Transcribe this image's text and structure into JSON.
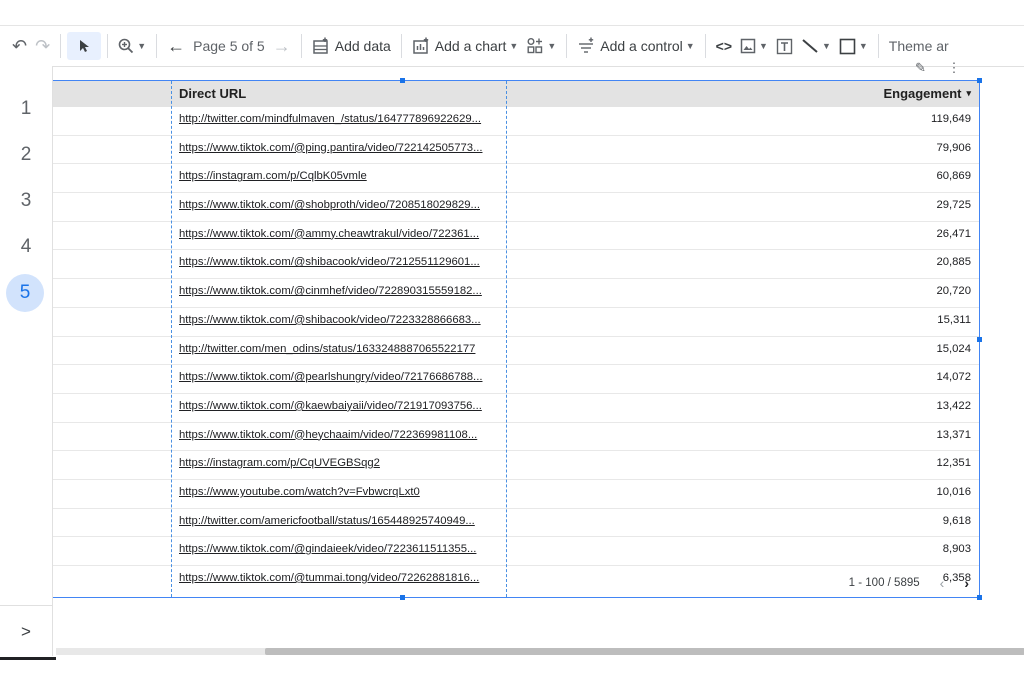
{
  "toolbar": {
    "undo_icon": "undo-icon",
    "redo_icon": "redo-icon",
    "select_icon": "pointer-icon",
    "zoom_icon": "zoom-in-icon",
    "page_label": "Page 5 of 5",
    "add_data": "Add data",
    "add_chart": "Add a chart",
    "add_control": "Add a control",
    "theme_label": "Theme ar"
  },
  "pages": [
    "1",
    "2",
    "3",
    "4",
    "5"
  ],
  "active_page": "5",
  "rail_expand": ">",
  "table": {
    "headers": {
      "url": "Direct URL",
      "engagement": "Engagement"
    },
    "sort_indicator": "▾",
    "rows": [
      {
        "url": "http://twitter.com/mindfulmaven_/status/164777896922629...",
        "engagement": "119,649"
      },
      {
        "url": "https://www.tiktok.com/@ping.pantira/video/722142505773...",
        "engagement": "79,906"
      },
      {
        "url": "https://instagram.com/p/CqlbK05vmle",
        "engagement": "60,869"
      },
      {
        "url": "https://www.tiktok.com/@shobproth/video/7208518029829...",
        "engagement": "29,725"
      },
      {
        "url": "https://www.tiktok.com/@ammy.cheawtrakul/video/722361...",
        "engagement": "26,471"
      },
      {
        "url": "https://www.tiktok.com/@shibacook/video/7212551129601...",
        "engagement": "20,885"
      },
      {
        "url": "https://www.tiktok.com/@cinmhef/video/722890315559182...",
        "engagement": "20,720"
      },
      {
        "url": "https://www.tiktok.com/@shibacook/video/7223328866683...",
        "engagement": "15,311"
      },
      {
        "url": "http://twitter.com/men_odins/status/1633248887065522177",
        "engagement": "15,024"
      },
      {
        "url": "https://www.tiktok.com/@pearlshungry/video/72176686788...",
        "engagement": "14,072"
      },
      {
        "url": "https://www.tiktok.com/@kaewbaiyaii/video/721917093756...",
        "engagement": "13,422"
      },
      {
        "url": "https://www.tiktok.com/@heychaaim/video/722369981108...",
        "engagement": "13,371"
      },
      {
        "url": "https://instagram.com/p/CqUVEGBSqg2",
        "engagement": "12,351"
      },
      {
        "url": "https://www.youtube.com/watch?v=FvbwcrqLxt0",
        "engagement": "10,016"
      },
      {
        "url": "http://twitter.com/americfootball/status/165448925740949...",
        "engagement": "9,618"
      },
      {
        "url": "https://www.tiktok.com/@gindaieek/video/7223611511355...",
        "engagement": "8,903"
      },
      {
        "url": "https://www.tiktok.com/@tummai.tong/video/72262881816...",
        "engagement": "6,358"
      }
    ],
    "pagination": "1 - 100 / 5895"
  },
  "colors": {
    "accent": "#1a73e8",
    "selection": "#4285f4",
    "active_page_bg": "#d2e3fc"
  }
}
